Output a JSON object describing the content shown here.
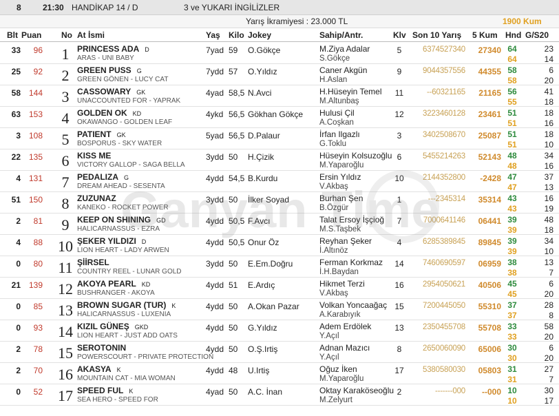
{
  "race": {
    "number": "8",
    "time": "21:30",
    "name": "HANDİKAP 14 / D",
    "category": "3 ve YUKARI İNGİLİZLER",
    "prize": "Yarış İkramiyesi : 23.000 TL",
    "distance": "1900 Kum"
  },
  "columns": {
    "blt": "Blt",
    "puan": "Puan",
    "no": "No",
    "at": "At İsmi",
    "yas": "Yaş",
    "kilo": "Kilo",
    "jokey": "Jokey",
    "sahip": "Sahip/Antr.",
    "klv": "Klv",
    "son10": "Son 10 Yarış",
    "kum5": "5 Kum",
    "hnd": "Hnd",
    "g20": "G/S20"
  },
  "watermark": "Ganyan Time",
  "horses": [
    {
      "blt": "33",
      "puan": "96",
      "no": "1",
      "name": "PRINCESS ADA",
      "flag": "D",
      "pedigree": "ARAS - UNI BABY",
      "yas": "7yad",
      "kilo": "59",
      "jokey": "O.Gökçe",
      "owner": "M.Ziya Adalar",
      "trainer": "S.Gökçe",
      "klv": "5",
      "son10": "6374527340",
      "kum5": "27340",
      "hnd1": "64",
      "hnd2": "64",
      "g1": "23",
      "g2": "14"
    },
    {
      "blt": "25",
      "puan": "92",
      "no": "2",
      "name": "GREEN PUSS",
      "flag": "G",
      "pedigree": "GREEN GÖNEN - LUCY CAT",
      "yas": "7ydd",
      "kilo": "57",
      "jokey": "O.Yıldız",
      "owner": "Caner Akgün",
      "trainer": "H.Aslan",
      "klv": "9",
      "son10": "9044357556",
      "kum5": "44355",
      "hnd1": "58",
      "hnd2": "58",
      "g1": "6",
      "g2": "20"
    },
    {
      "blt": "58",
      "puan": "144",
      "no": "3",
      "name": "CASSOWARY",
      "flag": "GK",
      "pedigree": "UNACCOUNTED FOR - YAPRAK",
      "yas": "4yad",
      "kilo": "58,5",
      "jokey": "N.Avci",
      "owner": "H.Hüseyin Temel",
      "trainer": "M.Altunbaş",
      "klv": "11",
      "son10": "--60321165",
      "kum5": "21165",
      "hnd1": "56",
      "hnd2": "55",
      "g1": "41",
      "g2": "18"
    },
    {
      "blt": "63",
      "puan": "153",
      "no": "4",
      "name": "GOLDEN OK",
      "flag": "KD",
      "pedigree": "OKAWANGO - GOLDEN LEAF",
      "yas": "4ykd",
      "kilo": "56,5",
      "jokey": "Gökhan Gökçe",
      "owner": "Hulusi Çil",
      "trainer": "A.Coşkan",
      "klv": "12",
      "son10": "3223460128",
      "kum5": "23461",
      "hnd1": "51",
      "hnd2": "51",
      "g1": "18",
      "g2": "16"
    },
    {
      "blt": "3",
      "puan": "108",
      "no": "5",
      "name": "PATIENT",
      "flag": "GK",
      "pedigree": "BOSPORUS - SKY WATER",
      "yas": "5yad",
      "kilo": "56,5",
      "jokey": "D.Palaur",
      "owner": "İrfan Ilgazlı",
      "trainer": "G.Toklu",
      "klv": "3",
      "son10": "3402508670",
      "kum5": "25087",
      "hnd1": "51",
      "hnd2": "51",
      "g1": "18",
      "g2": "10"
    },
    {
      "blt": "22",
      "puan": "135",
      "no": "6",
      "name": "KISS ME",
      "flag": "",
      "pedigree": "VICTORY GALLOP - SAGA BELLA",
      "yas": "3ydd",
      "kilo": "50",
      "jokey": "H.Çizik",
      "owner": "Hüseyin Kolsuzoğlu",
      "trainer": "M.Yaparoğlu",
      "klv": "6",
      "son10": "5455214263",
      "kum5": "52143",
      "hnd1": "48",
      "hnd2": "48",
      "g1": "34",
      "g2": "16"
    },
    {
      "blt": "4",
      "puan": "131",
      "no": "7",
      "name": "PEDALIZA",
      "flag": "G",
      "pedigree": "DREAM AHEAD - SESENTA",
      "yas": "4ydd",
      "kilo": "54,5",
      "jokey": "B.Kurdu",
      "owner": "Ersin Yıldız",
      "trainer": "V.Akbaş",
      "klv": "10",
      "son10": "2144352800",
      "kum5": "-2428",
      "hnd1": "47",
      "hnd2": "47",
      "g1": "37",
      "g2": "13"
    },
    {
      "blt": "51",
      "puan": "150",
      "no": "8",
      "name": "ZUZUNAZ",
      "flag": "",
      "pedigree": "KANEKO - ROCKET POWER",
      "yas": "3ydd",
      "kilo": "50",
      "jokey": "İlker Soyad",
      "owner": "Burhan Şen",
      "trainer": "B.Özgür",
      "klv": "1",
      "son10": "---2345314",
      "kum5": "35314",
      "hnd1": "43",
      "hnd2": "43",
      "g1": "16",
      "g2": "19"
    },
    {
      "blt": "2",
      "puan": "81",
      "no": "9",
      "name": "KEEP ON SHINING",
      "flag": "GD",
      "pedigree": "HALICARNASSUS - EZRA",
      "yas": "4ydd",
      "kilo": "50,5",
      "jokey": "F.Avcı",
      "owner": "Talat Ersoy İşçioğ",
      "trainer": "M.S.Taşbek",
      "klv": "7",
      "son10": "7000641146",
      "kum5": "06441",
      "hnd1": "39",
      "hnd2": "39",
      "g1": "48",
      "g2": "18"
    },
    {
      "blt": "4",
      "puan": "88",
      "no": "10",
      "name": "ŞEKER YILDIZI",
      "flag": "D",
      "pedigree": "LION HEART - LADY ARWEN",
      "yas": "4ydd",
      "kilo": "50,5",
      "jokey": "Onur Öz",
      "owner": "Reyhan Şeker",
      "trainer": "İ.Altınöz",
      "klv": "4",
      "son10": "6285389845",
      "kum5": "89845",
      "hnd1": "39",
      "hnd2": "39",
      "g1": "34",
      "g2": "10"
    },
    {
      "blt": "0",
      "puan": "80",
      "no": "11",
      "name": "ŞİİRSEL",
      "flag": "",
      "pedigree": "COUNTRY REEL - LUNAR GOLD",
      "yas": "3ydd",
      "kilo": "50",
      "jokey": "E.Em.Doğru",
      "owner": "Ferman Korkmaz",
      "trainer": "İ.H.Baydan",
      "klv": "14",
      "son10": "7460690597",
      "kum5": "06959",
      "hnd1": "38",
      "hnd2": "38",
      "g1": "13",
      "g2": "7"
    },
    {
      "blt": "21",
      "puan": "139",
      "no": "12",
      "name": "AKOYA PEARL",
      "flag": "KD",
      "pedigree": "BUSHRANGER - AKOYA",
      "yas": "4ydd",
      "kilo": "51",
      "jokey": "E.Ardıç",
      "owner": "Hikmet Terzi",
      "trainer": "V.Akbaş",
      "klv": "16",
      "son10": "2954050621",
      "kum5": "40506",
      "hnd1": "45",
      "hnd2": "45",
      "g1": "6",
      "g2": "20"
    },
    {
      "blt": "0",
      "puan": "85",
      "no": "13",
      "name": "BROWN SUGAR (TUR)",
      "flag": "K",
      "pedigree": "HALICARNASSUS - LUXENIA",
      "yas": "4ydd",
      "kilo": "50",
      "jokey": "A.Okan Pazar",
      "owner": "Volkan Yoncaağaç",
      "trainer": "A.Karabıyık",
      "klv": "15",
      "son10": "7200445050",
      "kum5": "55310",
      "hnd1": "37",
      "hnd2": "37",
      "g1": "28",
      "g2": "8"
    },
    {
      "blt": "0",
      "puan": "93",
      "no": "14",
      "name": "KIZIL GÜNEŞ",
      "flag": "GKD",
      "pedigree": "LION HEART - JUST ADD OATS",
      "yas": "4ydd",
      "kilo": "50",
      "jokey": "G.Yıldız",
      "owner": "Adem Erdölek",
      "trainer": "Y.Açıl",
      "klv": "13",
      "son10": "2350455708",
      "kum5": "55708",
      "hnd1": "33",
      "hnd2": "33",
      "g1": "58",
      "g2": "20"
    },
    {
      "blt": "2",
      "puan": "78",
      "no": "15",
      "name": "SEROTONIN",
      "flag": "",
      "pedigree": "POWERSCOURT - PRIVATE PROTECTION",
      "yas": "4ydd",
      "kilo": "50",
      "jokey": "O.Ş.Irtiş",
      "owner": "Adnan Mazıcı",
      "trainer": "Y.Açıl",
      "klv": "8",
      "son10": "2650060090",
      "kum5": "65006",
      "hnd1": "30",
      "hnd2": "30",
      "g1": "6",
      "g2": "20"
    },
    {
      "blt": "2",
      "puan": "70",
      "no": "16",
      "name": "AKASYA",
      "flag": "K",
      "pedigree": "MOUNTAIN CAT - MIA WOMAN",
      "yas": "4ydd",
      "kilo": "48",
      "jokey": "U.Irtiş",
      "owner": "Oğuz İken",
      "trainer": "M.Yaparoğlu",
      "klv": "17",
      "son10": "5380580030",
      "kum5": "05803",
      "hnd1": "31",
      "hnd2": "31",
      "g1": "27",
      "g2": "7"
    },
    {
      "blt": "0",
      "puan": "52",
      "no": "17",
      "name": "SPEED FUL",
      "flag": "K",
      "pedigree": "SEA HERO - SPEED FOR",
      "yas": "4yad",
      "kilo": "50",
      "jokey": "A.C. İnan",
      "owner": "Oktay Karaköseoğlu",
      "trainer": "M.Zelyurt",
      "klv": "2",
      "son10": "-------000",
      "kum5": "--000",
      "hnd1": "10",
      "hnd2": "10",
      "g1": "30",
      "g2": "17"
    }
  ]
}
